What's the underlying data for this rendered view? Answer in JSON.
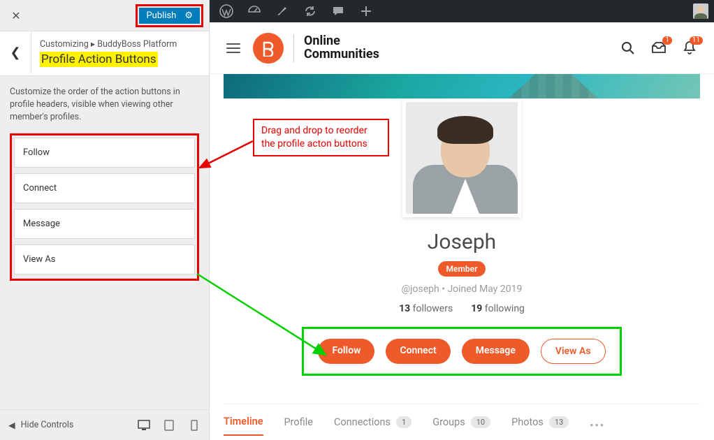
{
  "customizer": {
    "publish_label": "Publish",
    "breadcrumb_line": "Customizing ▸ BuddyBoss Platform",
    "title": "Profile Action Buttons",
    "description": "Customize the order of the action buttons in profile headers, visible when viewing other member's profiles.",
    "items": [
      "Follow",
      "Connect",
      "Message",
      "View As"
    ],
    "hide_controls": "Hide Controls"
  },
  "site": {
    "brand_line1": "Online",
    "brand_line2": "Communities",
    "badges": {
      "inbox": "1",
      "bell": "11"
    }
  },
  "profile": {
    "name": "Joseph",
    "badge": "Member",
    "handle": "@joseph",
    "joined": "Joined May 2019",
    "followers_count": "13",
    "followers_label": "followers",
    "following_count": "19",
    "following_label": "following",
    "actions": [
      {
        "label": "Follow",
        "style": "solid"
      },
      {
        "label": "Connect",
        "style": "solid"
      },
      {
        "label": "Message",
        "style": "solid"
      },
      {
        "label": "View As",
        "style": "outline"
      }
    ]
  },
  "tabs": [
    {
      "label": "Timeline",
      "active": true
    },
    {
      "label": "Profile"
    },
    {
      "label": "Connections",
      "count": "1"
    },
    {
      "label": "Groups",
      "count": "10"
    },
    {
      "label": "Photos",
      "count": "13"
    }
  ],
  "annotation": {
    "text": "Drag and drop to reorder the profile acton buttons"
  }
}
